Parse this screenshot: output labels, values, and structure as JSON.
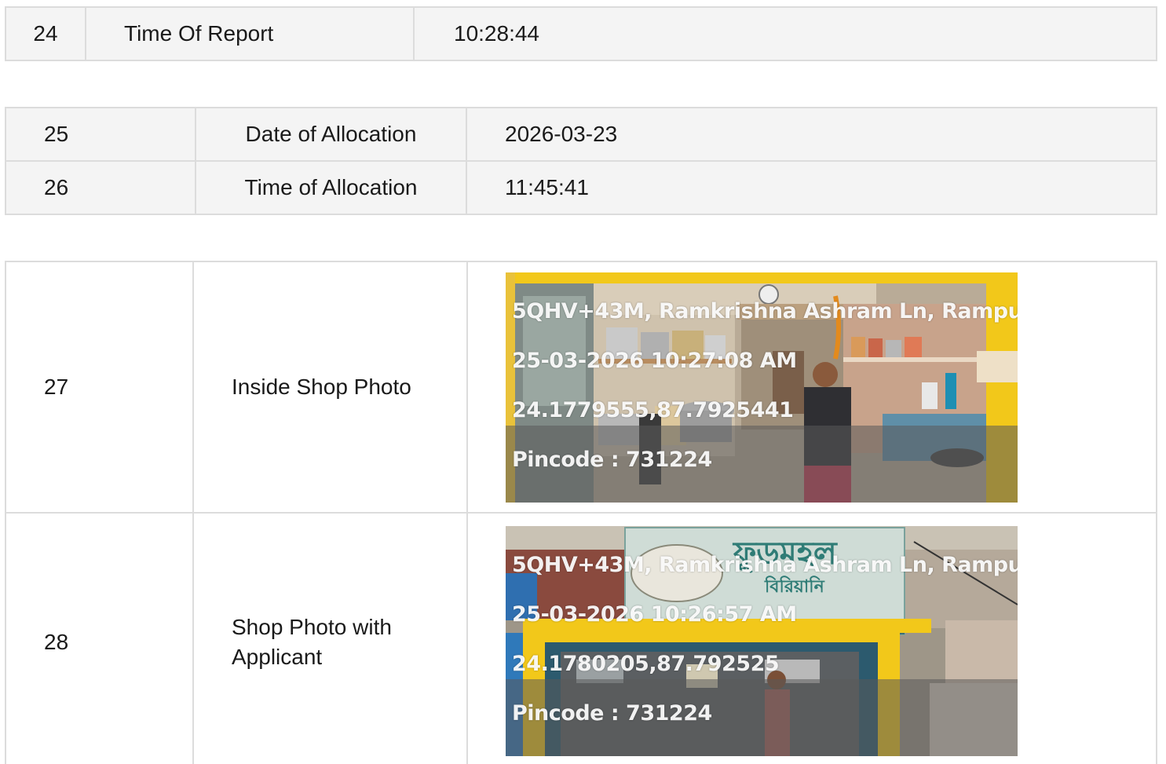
{
  "report_rows": [
    {
      "no": "24",
      "label": "Time Of Report",
      "value": "10:28:44"
    }
  ],
  "allocation_rows": [
    {
      "no": "25",
      "label": "Date of Allocation",
      "value": "2026-03-23"
    },
    {
      "no": "26",
      "label": "Time of Allocation",
      "value": "11:45:41"
    }
  ],
  "photo_rows": [
    {
      "no": "27",
      "label": "Inside Shop Photo",
      "stamp": {
        "line1": "5QHV+43M, Ramkrishna Ashram Ln, Rampu",
        "line2": "25-03-2026 10:27:08 AM",
        "line3": "24.1779555,87.7925441",
        "line4": "Pincode : 731224"
      }
    },
    {
      "no": "28",
      "label": "Shop Photo with Applicant",
      "stamp": {
        "line1": "5QHV+43M, Ramkrishna Ashram Ln, Rampu",
        "line2": "25-03-2026 10:26:57 AM",
        "line3": "24.1780205,87.792525",
        "line4": "Pincode : 731224"
      }
    }
  ],
  "colors": {
    "border": "#dcdcdc",
    "row_bg": "#f4f4f4",
    "stamp_text": "#ffffff",
    "shop_yellow": "#f2c81a"
  }
}
